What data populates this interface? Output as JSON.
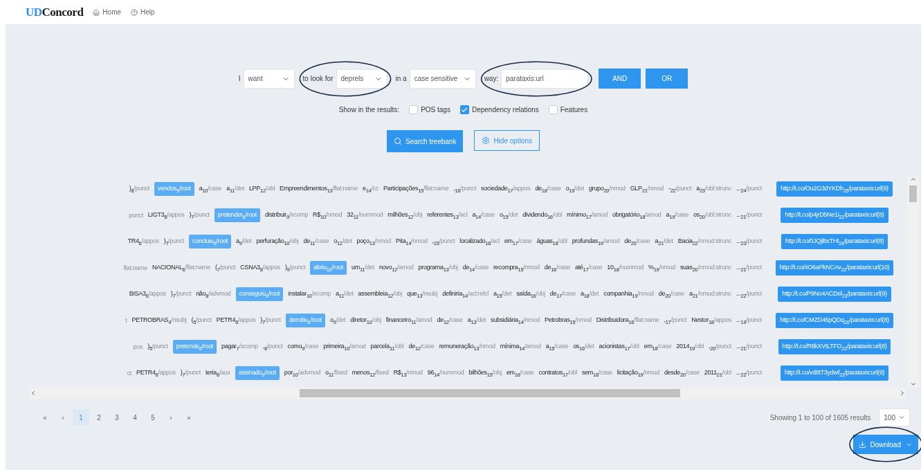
{
  "header": {
    "logo": {
      "prefix": "UD",
      "name": "Concord"
    },
    "nav": [
      "Home",
      "Help"
    ]
  },
  "query": {
    "prefix": "I",
    "want": "want",
    "look_label": "to look for",
    "look": "deprels",
    "in_label": "in a",
    "case": "case sensitive",
    "way_label": "way:",
    "value": "parataxis:url",
    "buttons": [
      "AND",
      "OR"
    ]
  },
  "show": {
    "label": "Show in the results:",
    "options": [
      {
        "label": "POS tags",
        "checked": false
      },
      {
        "label": "Dependency relations",
        "checked": true
      },
      {
        "label": "Features",
        "checked": false
      }
    ]
  },
  "actions": {
    "search": "Search treebank",
    "hide": "Hide options"
  },
  "rows": [
    {
      "tokens": [
        {
          "word": ")",
          "index": "8",
          "rel": "/punct",
          "highlighted": false
        },
        {
          "word": "vendos",
          "index": "9",
          "rel": "/root",
          "highlighted": true
        },
        {
          "word": "a",
          "index": "10",
          "rel": "/case",
          "highlighted": false
        },
        {
          "word": "a",
          "index": "11",
          "rel": "/det",
          "highlighted": false
        },
        {
          "word": "LPP",
          "index": "12",
          "rel": "/obl",
          "highlighted": false
        },
        {
          "word": "Empreendimentos",
          "index": "13",
          "rel": "/flat:name",
          "highlighted": false
        },
        {
          "word": "e",
          "index": "14",
          "rel": "/cc",
          "highlighted": false
        },
        {
          "word": "Participações",
          "index": "15",
          "rel": "/flat:name",
          "highlighted": false
        },
        {
          "word": ",",
          "index": "16",
          "rel": "/punct",
          "highlighted": false
        },
        {
          "word": "sociedade",
          "index": "17",
          "rel": "/appos",
          "highlighted": false
        },
        {
          "word": "de",
          "index": "18",
          "rel": "/case",
          "highlighted": false
        },
        {
          "word": "o",
          "index": "19",
          "rel": "/det",
          "highlighted": false
        },
        {
          "word": "grupo",
          "index": "20",
          "rel": "/nmod",
          "highlighted": false
        },
        {
          "word": "GLP",
          "index": "21",
          "rel": "/nmod",
          "highlighted": false
        },
        {
          "word": "-",
          "index": "22",
          "rel": "/punct",
          "highlighted": false
        },
        {
          "word": "a",
          "index": "23",
          "rel": "/obl:strunc",
          "highlighted": false
        },
        {
          "word": "...",
          "index": "24",
          "rel": "/punct",
          "highlighted": false
        }
      ],
      "url": {
        "word": "http://t.co/Ou2G3dYKDh",
        "index": "25",
        "rel": "/parataxis:url(9)"
      }
    },
    {
      "tokens": [
        {
          "rel": "punct",
          "highlighted": false
        },
        {
          "word": "LIGT3",
          "index": "6",
          "rel": "/appos",
          "highlighted": false
        },
        {
          "word": ")",
          "index": "7",
          "rel": "/punct",
          "highlighted": false
        },
        {
          "word": "pretender",
          "index": "8",
          "rel": "/root",
          "highlighted": true
        },
        {
          "word": "distribuir",
          "index": "9",
          "rel": "/xcomp",
          "highlighted": false
        },
        {
          "word": "R$",
          "index": "10",
          "rel": "/nmod",
          "highlighted": false
        },
        {
          "word": "32",
          "index": "11",
          "rel": "/nummod",
          "highlighted": false
        },
        {
          "word": "milhões",
          "index": "12",
          "rel": "/obj",
          "highlighted": false
        },
        {
          "word": "referentes",
          "index": "13",
          "rel": "/acl",
          "highlighted": false
        },
        {
          "word": "a",
          "index": "14",
          "rel": "/case",
          "highlighted": false
        },
        {
          "word": "o",
          "index": "15",
          "rel": "/det",
          "highlighted": false
        },
        {
          "word": "dividendo",
          "index": "16",
          "rel": "/obl",
          "highlighted": false
        },
        {
          "word": "mínimo",
          "index": "17",
          "rel": "/amod",
          "highlighted": false
        },
        {
          "word": "obrigatório",
          "index": "18",
          "rel": "/amod",
          "highlighted": false
        },
        {
          "word": "a",
          "index": "19",
          "rel": "/case",
          "highlighted": false
        },
        {
          "word": "os",
          "index": "20",
          "rel": "/obl:strunc",
          "highlighted": false
        },
        {
          "word": "...",
          "index": "21",
          "rel": "/punct",
          "highlighted": false
        }
      ],
      "url": {
        "word": "http://t.co/p4jrD5Ne1i",
        "index": "22",
        "rel": "/parataxis:url(8)"
      }
    },
    {
      "tokens": [
        {
          "word": "TR4",
          "index": "6",
          "rel": "/appos",
          "highlighted": false
        },
        {
          "word": ")",
          "index": "7",
          "rel": "/punct",
          "highlighted": false
        },
        {
          "word": "concluiu",
          "index": "8",
          "rel": "/root",
          "highlighted": true
        },
        {
          "word": "a",
          "index": "9",
          "rel": "/det",
          "highlighted": false
        },
        {
          "word": "perfuração",
          "index": "10",
          "rel": "/obj",
          "highlighted": false
        },
        {
          "word": "de",
          "index": "11",
          "rel": "/case",
          "highlighted": false
        },
        {
          "word": "o",
          "index": "12",
          "rel": "/det",
          "highlighted": false
        },
        {
          "word": "poço",
          "index": "13",
          "rel": "/nmod",
          "highlighted": false
        },
        {
          "word": "Pita",
          "index": "14",
          "rel": "/nmod",
          "highlighted": false
        },
        {
          "word": ",",
          "index": "15",
          "rel": "/punct",
          "highlighted": false
        },
        {
          "word": "localizado",
          "index": "16",
          "rel": "/acl",
          "highlighted": false
        },
        {
          "word": "em",
          "index": "17",
          "rel": "/case",
          "highlighted": false
        },
        {
          "word": "águas",
          "index": "18",
          "rel": "/obl",
          "highlighted": false
        },
        {
          "word": "profundas",
          "index": "19",
          "rel": "/amod",
          "highlighted": false
        },
        {
          "word": "de",
          "index": "20",
          "rel": "/case",
          "highlighted": false
        },
        {
          "word": "a",
          "index": "21",
          "rel": "/det",
          "highlighted": false
        },
        {
          "word": "Bacia",
          "index": "22",
          "rel": "/nmod:strunc",
          "highlighted": false
        },
        {
          "word": "...",
          "index": "23",
          "rel": "/punct",
          "highlighted": false
        }
      ],
      "url": {
        "word": "http://t.co/0JQjl8xTHt",
        "index": "24",
        "rel": "/parataxis:url(8)"
      }
    },
    {
      "tokens": [
        {
          "rel": "flat:name",
          "highlighted": false
        },
        {
          "word": "NACIONAL",
          "index": "6",
          "rel": "/flat:name",
          "highlighted": false
        },
        {
          "word": "(",
          "index": "7",
          "rel": "/punct",
          "highlighted": false
        },
        {
          "word": "CSNA3",
          "index": "8",
          "rel": "/appos",
          "highlighted": false
        },
        {
          "word": ")",
          "index": "9",
          "rel": "/punct",
          "highlighted": false
        },
        {
          "word": "abriu",
          "index": "10",
          "rel": "/root",
          "highlighted": true
        },
        {
          "word": "um",
          "index": "11",
          "rel": "/det",
          "highlighted": false
        },
        {
          "word": "novo",
          "index": "12",
          "rel": "/amod",
          "highlighted": false
        },
        {
          "word": "programa",
          "index": "13",
          "rel": "/obj",
          "highlighted": false
        },
        {
          "word": "de",
          "index": "14",
          "rel": "/case",
          "highlighted": false
        },
        {
          "word": "recompra",
          "index": "15",
          "rel": "/nmod",
          "highlighted": false
        },
        {
          "word": "de",
          "index": "16",
          "rel": "/case",
          "highlighted": false
        },
        {
          "word": "até",
          "index": "17",
          "rel": "/case",
          "highlighted": false
        },
        {
          "word": "10",
          "index": "18",
          "rel": "/nummod",
          "highlighted": false
        },
        {
          "word": "%",
          "index": "19",
          "rel": "/nmod",
          "highlighted": false
        },
        {
          "word": "suas",
          "index": "20",
          "rel": "/nmod:strunc",
          "highlighted": false
        },
        {
          "word": "...",
          "index": "21",
          "rel": "/punct",
          "highlighted": false
        }
      ],
      "url": {
        "word": "http://t.co/4O6aPkNCAv",
        "index": "22",
        "rel": "/parataxis:url(10)"
      }
    },
    {
      "tokens": [
        {
          "word": "BISA3",
          "index": "6",
          "rel": "/appos",
          "highlighted": false
        },
        {
          "word": ")",
          "index": "7",
          "rel": "/punct",
          "highlighted": false
        },
        {
          "word": "não",
          "index": "8",
          "rel": "/advmod",
          "highlighted": false
        },
        {
          "word": "conseguiu",
          "index": "9",
          "rel": "/root",
          "highlighted": true
        },
        {
          "word": "instalar",
          "index": "10",
          "rel": "/xcomp",
          "highlighted": false
        },
        {
          "word": "a",
          "index": "11",
          "rel": "/det",
          "highlighted": false
        },
        {
          "word": "assembleia",
          "index": "12",
          "rel": "/obj",
          "highlighted": false
        },
        {
          "word": "que",
          "index": "13",
          "rel": "/nsubj",
          "highlighted": false
        },
        {
          "word": "definiria",
          "index": "14",
          "rel": "/acl:relcl",
          "highlighted": false
        },
        {
          "word": "a",
          "index": "15",
          "rel": "/det",
          "highlighted": false
        },
        {
          "word": "saída",
          "index": "16",
          "rel": "/obj",
          "highlighted": false
        },
        {
          "word": "de",
          "index": "17",
          "rel": "/case",
          "highlighted": false
        },
        {
          "word": "a",
          "index": "18",
          "rel": "/det",
          "highlighted": false
        },
        {
          "word": "companhia",
          "index": "19",
          "rel": "/nmod",
          "highlighted": false
        },
        {
          "word": "de",
          "index": "20",
          "rel": "/case",
          "highlighted": false
        },
        {
          "word": "a",
          "index": "21",
          "rel": "/nmod:strunc",
          "highlighted": false
        },
        {
          "word": "...",
          "index": "22",
          "rel": "/punct",
          "highlighted": false
        }
      ],
      "url": {
        "word": "http://t.co/P9No4ACDel",
        "index": "23",
        "rel": "/parataxis:url(9)"
      }
    },
    {
      "tokens": [
        {
          "rel": "t",
          "highlighted": false
        },
        {
          "word": "PETROBRAS",
          "index": "4",
          "rel": "/nsubj",
          "highlighted": false
        },
        {
          "word": "(",
          "index": "5",
          "rel": "/punct",
          "highlighted": false
        },
        {
          "word": "PETR4",
          "index": "6",
          "rel": "/appos",
          "highlighted": false
        },
        {
          "word": ")",
          "index": "7",
          "rel": "/punct",
          "highlighted": false
        },
        {
          "word": "demitiu",
          "index": "8",
          "rel": "/root",
          "highlighted": true
        },
        {
          "word": "o",
          "index": "9",
          "rel": "/det",
          "highlighted": false
        },
        {
          "word": "diretor",
          "index": "10",
          "rel": "/obj",
          "highlighted": false
        },
        {
          "word": "financeiro",
          "index": "11",
          "rel": "/amod",
          "highlighted": false
        },
        {
          "word": "de",
          "index": "12",
          "rel": "/case",
          "highlighted": false
        },
        {
          "word": "a",
          "index": "13",
          "rel": "/det",
          "highlighted": false
        },
        {
          "word": "subsidiária",
          "index": "14",
          "rel": "/nmod",
          "highlighted": false
        },
        {
          "word": "Petrobras",
          "index": "15",
          "rel": "/nmod",
          "highlighted": false
        },
        {
          "word": "Distribuidora",
          "index": "16",
          "rel": "/flat:name",
          "highlighted": false
        },
        {
          "word": ",",
          "index": "17",
          "rel": "/punct",
          "highlighted": false
        },
        {
          "word": "Nestor",
          "index": "18",
          "rel": "/appos",
          "highlighted": false
        },
        {
          "word": "...",
          "index": "19",
          "rel": "/punct",
          "highlighted": false
        }
      ],
      "url": {
        "word": "http://t.co/CMZD46pQDq",
        "index": "20",
        "rel": "/parataxis:url(8)"
      }
    },
    {
      "tokens": [
        {
          "rel": "pos",
          "highlighted": false
        },
        {
          "word": ")",
          "index": "5",
          "rel": "/punct",
          "highlighted": false
        },
        {
          "word": "pretende",
          "index": "6",
          "rel": "/root",
          "highlighted": true
        },
        {
          "word": "pagar",
          "index": "7",
          "rel": "/xcomp",
          "highlighted": false
        },
        {
          "word": ",",
          "index": "8",
          "rel": "/punct",
          "highlighted": false
        },
        {
          "word": "como",
          "index": "9",
          "rel": "/case",
          "highlighted": false
        },
        {
          "word": "primeira",
          "index": "10",
          "rel": "/amod",
          "highlighted": false
        },
        {
          "word": "parcela",
          "index": "11",
          "rel": "/obl",
          "highlighted": false
        },
        {
          "word": "de",
          "index": "12",
          "rel": "/case",
          "highlighted": false
        },
        {
          "word": "remuneração",
          "index": "13",
          "rel": "/nmod",
          "highlighted": false
        },
        {
          "word": "mínima",
          "index": "14",
          "rel": "/amod",
          "highlighted": false
        },
        {
          "word": "a",
          "index": "15",
          "rel": "/case",
          "highlighted": false
        },
        {
          "word": "os",
          "index": "16",
          "rel": "/det",
          "highlighted": false
        },
        {
          "word": "acionistas",
          "index": "17",
          "rel": "/obl",
          "highlighted": false
        },
        {
          "word": "em",
          "index": "18",
          "rel": "/case",
          "highlighted": false
        },
        {
          "word": "2014",
          "index": "19",
          "rel": "/obl",
          "highlighted": false
        },
        {
          "word": ",",
          "index": "20",
          "rel": "/punct",
          "highlighted": false
        },
        {
          "word": "...",
          "index": "21",
          "rel": "/punct",
          "highlighted": false
        }
      ],
      "url": {
        "word": "http://t.co/R8kXVtLTFO",
        "index": "22",
        "rel": "/parataxis:url(8)"
      }
    },
    {
      "tokens": [
        {
          "rel": "ct",
          "highlighted": false
        },
        {
          "word": "PETR4",
          "index": "6",
          "rel": "/appos",
          "highlighted": false
        },
        {
          "word": ")",
          "index": "7",
          "rel": "/punct",
          "highlighted": false
        },
        {
          "word": "teria",
          "index": "8",
          "rel": "/aux",
          "highlighted": false
        },
        {
          "word": "assinado",
          "index": "9",
          "rel": "/root",
          "highlighted": true
        },
        {
          "word": "por",
          "index": "10",
          "rel": "/advmod",
          "highlighted": false
        },
        {
          "word": "o",
          "index": "11",
          "rel": "/fixed",
          "highlighted": false
        },
        {
          "word": "menos",
          "index": "12",
          "rel": "/fixed",
          "highlighted": false
        },
        {
          "word": "R$",
          "index": "13",
          "rel": "/nmod",
          "highlighted": false
        },
        {
          "word": "96",
          "index": "14",
          "rel": "/nummod",
          "highlighted": false
        },
        {
          "word": "bilhões",
          "index": "15",
          "rel": "/obj",
          "highlighted": false
        },
        {
          "word": "em",
          "index": "16",
          "rel": "/case",
          "highlighted": false
        },
        {
          "word": "contratos",
          "index": "17",
          "rel": "/obl",
          "highlighted": false
        },
        {
          "word": "sem",
          "index": "18",
          "rel": "/case",
          "highlighted": false
        },
        {
          "word": "licitação",
          "index": "19",
          "rel": "/nmod",
          "highlighted": false
        },
        {
          "word": "desde",
          "index": "20",
          "rel": "/case",
          "highlighted": false
        },
        {
          "word": "2011",
          "index": "21",
          "rel": "/obl",
          "highlighted": false
        },
        {
          "word": "...",
          "index": "22",
          "rel": "/punct",
          "highlighted": false
        }
      ],
      "url": {
        "word": "http://t.co/vd8tT3ydwf",
        "index": "23",
        "rel": "/parataxis:url(9)"
      }
    }
  ],
  "pagination": [
    {
      "label": "«",
      "selected": false
    },
    {
      "label": "‹",
      "selected": false
    },
    {
      "label": "1",
      "selected": true
    },
    {
      "label": "2",
      "selected": false
    },
    {
      "label": "3",
      "selected": false
    },
    {
      "label": "4",
      "selected": false
    },
    {
      "label": "5",
      "selected": false
    },
    {
      "label": "›",
      "selected": false
    },
    {
      "label": "»",
      "selected": false
    }
  ],
  "summary": "Showing 1 to 100 of 1605 results",
  "page_size": "100",
  "download": "Download"
}
